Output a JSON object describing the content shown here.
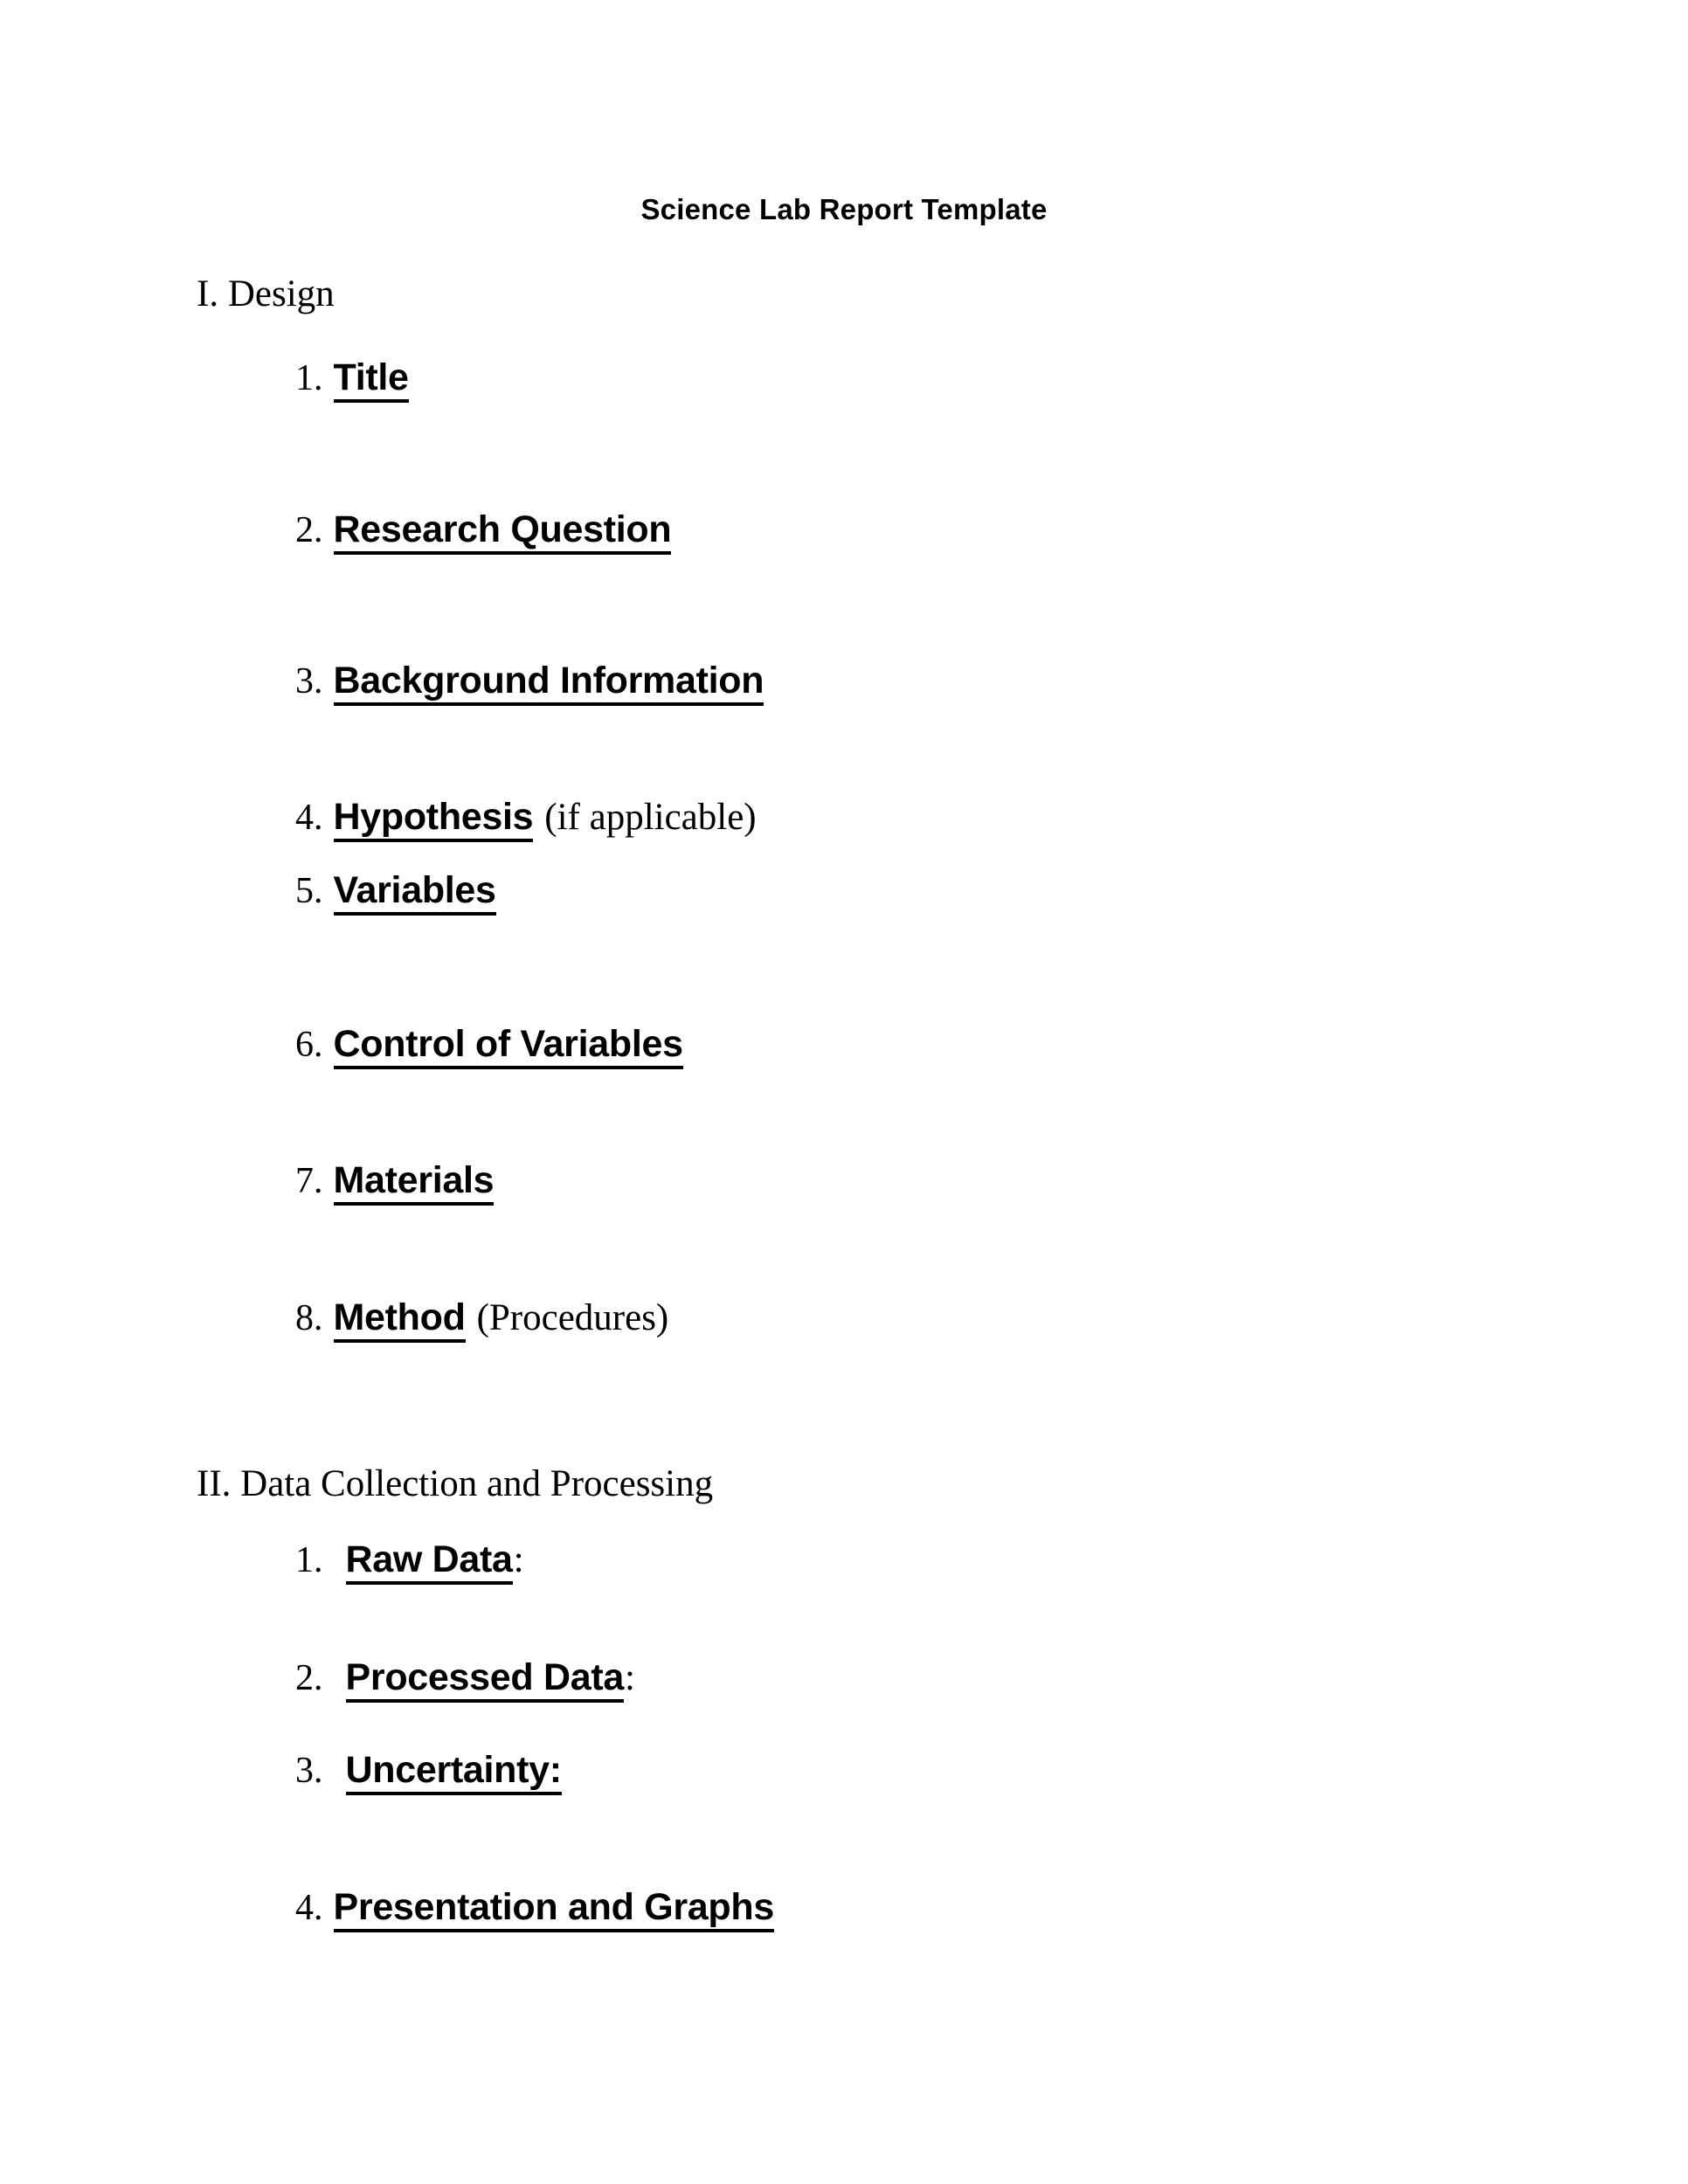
{
  "document": {
    "title": "Science Lab Report Template",
    "background_color": "#ffffff",
    "text_color": "#000000"
  },
  "sections": [
    {
      "numeral": "I. Design",
      "items": [
        {
          "number": "1.",
          "label": "Title",
          "suffix": "",
          "suffix_style": "none",
          "number_gap": "normal"
        },
        {
          "number": "2.",
          "label": "Research Question",
          "suffix": "",
          "suffix_style": "none",
          "number_gap": "normal"
        },
        {
          "number": "3.",
          "label": "Background Information",
          "suffix": "",
          "suffix_style": "none",
          "number_gap": "normal"
        },
        {
          "number": "4.",
          "label": "Hypothesis",
          "suffix": "(if applicable)",
          "suffix_style": "serif",
          "number_gap": "normal"
        },
        {
          "number": "5.",
          "label": "Variables",
          "suffix": "",
          "suffix_style": "none",
          "number_gap": "normal"
        },
        {
          "number": "6.",
          "label": "Control of Variables",
          "suffix": "",
          "suffix_style": "none",
          "number_gap": "normal"
        },
        {
          "number": "7.",
          "label": "Materials",
          "suffix": "",
          "suffix_style": "none",
          "number_gap": "normal"
        },
        {
          "number": "8.",
          "label": "Method",
          "suffix": "(Procedures)",
          "suffix_style": "serif",
          "number_gap": "normal"
        }
      ]
    },
    {
      "numeral": "II. Data Collection and Processing",
      "items": [
        {
          "number": "1.",
          "label": "Raw Data",
          "suffix": ":",
          "suffix_style": "colon",
          "number_gap": "wide"
        },
        {
          "number": "2.",
          "label": "Processed Data",
          "suffix": ":",
          "suffix_style": "colon",
          "number_gap": "wide"
        },
        {
          "number": "3.",
          "label": "Uncertainty:",
          "suffix": "",
          "suffix_style": "none",
          "number_gap": "wide"
        },
        {
          "number": "4.",
          "label": "Presentation and Graphs",
          "suffix": "",
          "suffix_style": "none",
          "number_gap": "normal"
        }
      ]
    }
  ],
  "layout": {
    "section_tops": [
      313,
      1675
    ],
    "item_tops": [
      [
        409,
        583,
        756,
        912,
        996,
        1172,
        1328,
        1485
      ],
      [
        1762,
        1897,
        2003,
        2160
      ]
    ]
  }
}
